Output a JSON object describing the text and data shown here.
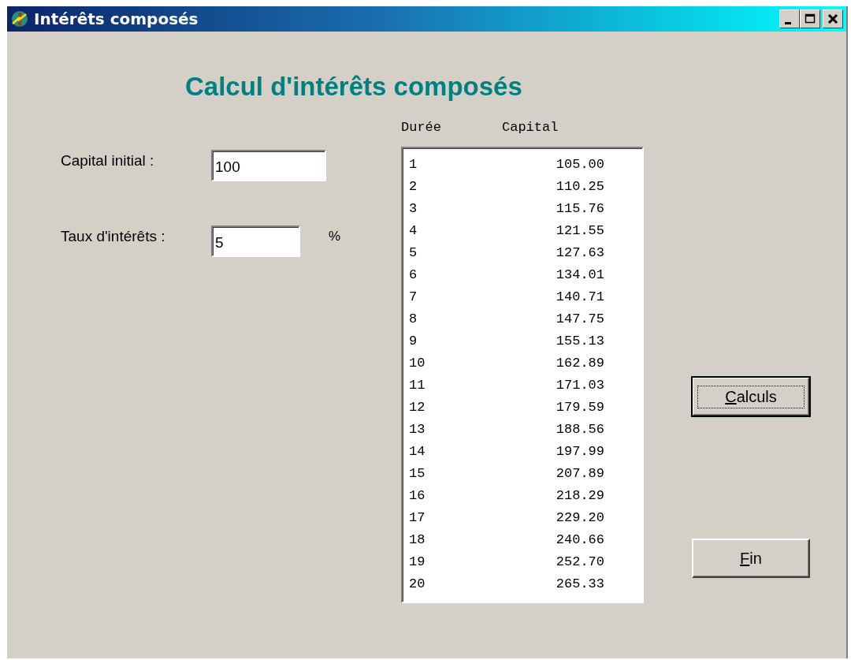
{
  "window": {
    "title": "Intérêts composés",
    "controls": [
      {
        "kind": "minimize"
      },
      {
        "kind": "maximize"
      },
      {
        "kind": "close"
      }
    ]
  },
  "heading": "Calcul d'intérêts composés",
  "fields": [
    {
      "label": "Capital initial :",
      "value": "100"
    },
    {
      "label": "Taux d'intérêts :",
      "value": "5",
      "unit": "%"
    }
  ],
  "table": {
    "columns": [
      "Durée",
      "Capital"
    ],
    "rows": [
      [
        "1",
        "105.00"
      ],
      [
        "2",
        "110.25"
      ],
      [
        "3",
        "115.76"
      ],
      [
        "4",
        "121.55"
      ],
      [
        "5",
        "127.63"
      ],
      [
        "6",
        "134.01"
      ],
      [
        "7",
        "140.71"
      ],
      [
        "8",
        "147.75"
      ],
      [
        "9",
        "155.13"
      ],
      [
        "10",
        "162.89"
      ],
      [
        "11",
        "171.03"
      ],
      [
        "12",
        "179.59"
      ],
      [
        "13",
        "188.56"
      ],
      [
        "14",
        "197.99"
      ],
      [
        "15",
        "207.89"
      ],
      [
        "16",
        "218.29"
      ],
      [
        "17",
        "229.20"
      ],
      [
        "18",
        "240.66"
      ],
      [
        "19",
        "252.70"
      ],
      [
        "20",
        "265.33"
      ]
    ]
  },
  "buttons": [
    {
      "label": "Calculs",
      "default": true
    },
    {
      "label": "Fin",
      "default": false
    }
  ]
}
